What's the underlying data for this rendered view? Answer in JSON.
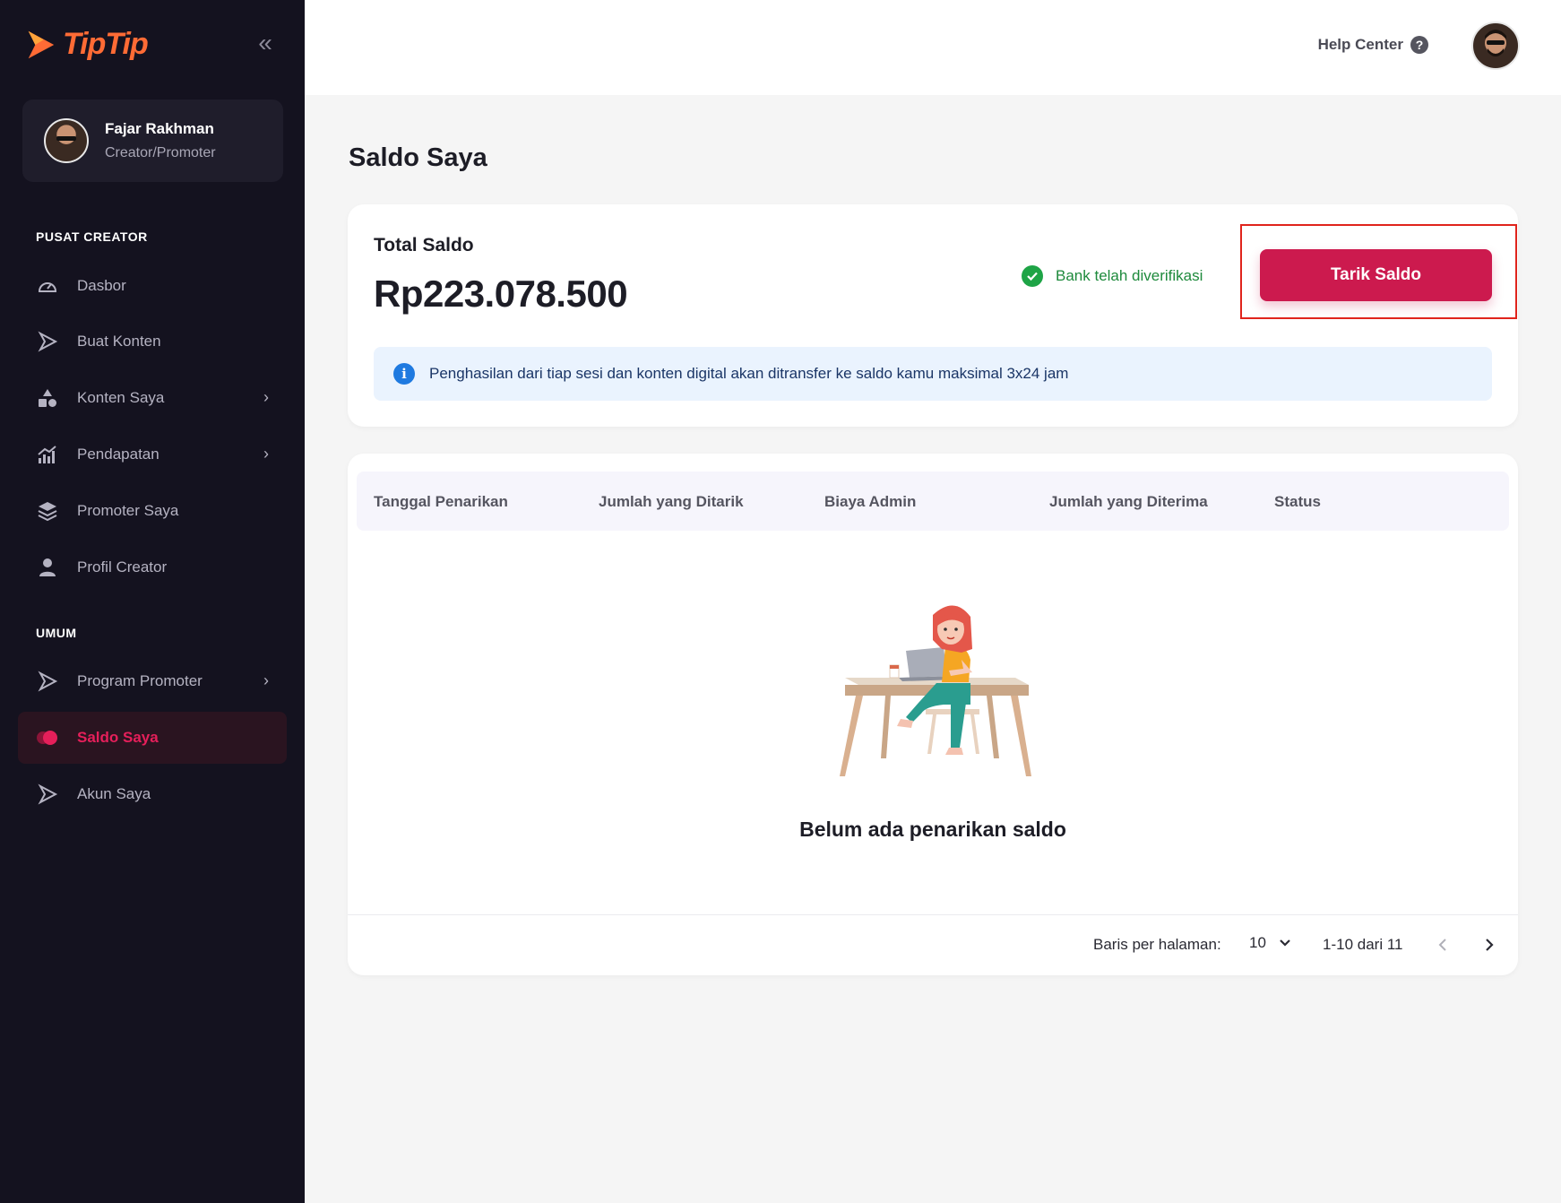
{
  "brand": {
    "name": "TipTip",
    "color": "#ff6b35",
    "accent": "#cc1a4e"
  },
  "sidebar": {
    "collapse_icon": "double-chevron-left-icon",
    "profile": {
      "name": "Fajar Rakhman",
      "role": "Creator/Promoter"
    },
    "sections": [
      {
        "title": "PUSAT CREATOR"
      },
      {
        "title": "UMUM"
      }
    ],
    "items": [
      {
        "label": "Dasbor",
        "icon": "speedometer-icon"
      },
      {
        "label": "Buat Konten",
        "icon": "play-arrow-icon"
      },
      {
        "label": "Konten Saya",
        "icon": "shapes-icon",
        "has_submenu": true
      },
      {
        "label": "Pendapatan",
        "icon": "bar-chart-icon",
        "has_submenu": true
      },
      {
        "label": "Promoter Saya",
        "icon": "layers-icon"
      },
      {
        "label": "Profil Creator",
        "icon": "person-icon"
      },
      {
        "label": "Program Promoter",
        "icon": "play-arrow-icon",
        "has_submenu": true
      },
      {
        "label": "Saldo Saya",
        "icon": "coins-icon",
        "active": true
      },
      {
        "label": "Akun Saya",
        "icon": "play-arrow-icon"
      }
    ]
  },
  "topbar": {
    "help_label": "Help Center",
    "help_icon": "question-circle-icon"
  },
  "main": {
    "title": "Saldo Saya",
    "saldo": {
      "label": "Total Saldo",
      "value": "Rp223.078.500",
      "verified_text": "Bank telah diverifikasi",
      "withdraw_button": "Tarik Saldo",
      "info_text": "Penghasilan dari tiap sesi dan konten digital akan ditransfer ke saldo kamu maksimal 3x24 jam"
    },
    "table": {
      "columns": [
        "Tanggal Penarikan",
        "Jumlah yang Ditarik",
        "Biaya Admin",
        "Jumlah yang Diterima",
        "Status"
      ],
      "rows": [],
      "empty_text": "Belum ada penarikan saldo"
    },
    "pagination": {
      "rows_label": "Baris per halaman:",
      "rows_value": "10",
      "range": "1-10 dari 11"
    }
  }
}
